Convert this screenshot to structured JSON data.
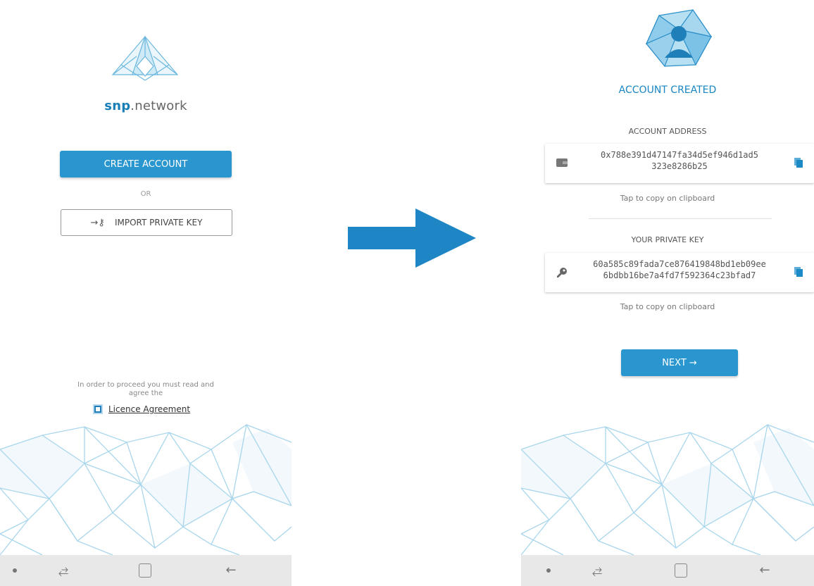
{
  "left": {
    "brand_bold": "snp",
    "brand_rest": ".network",
    "create_account_label": "CREATE ACCOUNT",
    "or_label": "OR",
    "import_key_label": "IMPORT PRIVATE KEY",
    "agree_text": "In order to proceed you must read and agree the",
    "licence_label": "Licence Agreement",
    "licence_checked": true
  },
  "right": {
    "title": "ACCOUNT CREATED",
    "address_label": "ACCOUNT ADDRESS",
    "address_line1": "0x788e391d47147fa34d5ef946d1ad5",
    "address_line2": "323e8286b25",
    "address_tap": "Tap to copy on clipboard",
    "key_label": "YOUR PRIVATE KEY",
    "key_line1": "60a585c89fada7ce876419848bd1eb09ee",
    "key_line2": "6bdbb16be7a4fd7f592364c23bfad7",
    "key_tap": "Tap to copy on clipboard",
    "next_label": "NEXT →"
  },
  "colors": {
    "accent": "#2a96cf",
    "title_blue": "#1a86c3",
    "poly_line": "#a9d6ec",
    "nav_bg": "#e8e8e8",
    "arrow": "#1e86c5"
  },
  "icons": {
    "logo": "snp-triangle-logo",
    "avatar": "user-avatar-polygon-logo",
    "wallet": "wallet-icon",
    "key": "key-icon",
    "copy": "copy-icon",
    "import": "key-arrow-icon",
    "nav": [
      "dot-icon",
      "recent-apps-icon",
      "home-icon",
      "back-icon"
    ]
  }
}
